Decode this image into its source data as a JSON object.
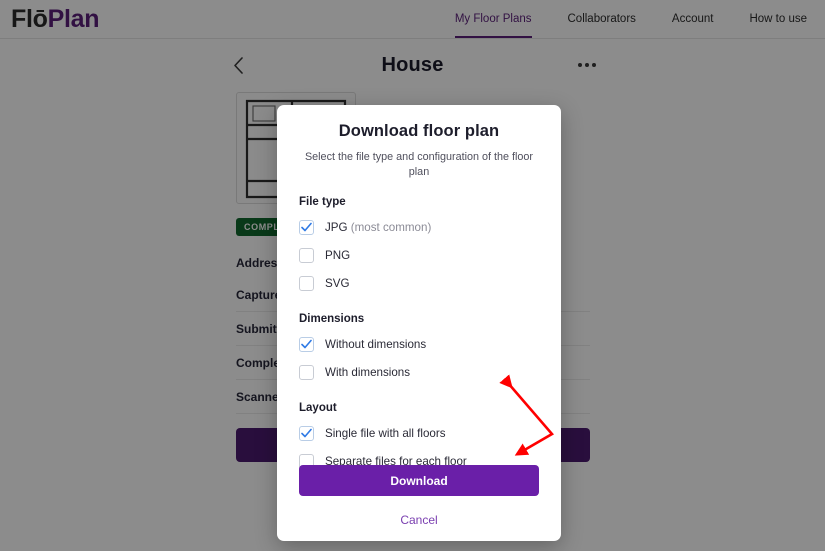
{
  "header": {
    "logo_primary": "Flō",
    "logo_accent": "Plan",
    "nav": [
      {
        "label": "My Floor Plans",
        "active": true
      },
      {
        "label": "Collaborators",
        "active": false
      },
      {
        "label": "Account",
        "active": false
      },
      {
        "label": "How to use",
        "active": false
      }
    ]
  },
  "detail": {
    "title": "House",
    "back_icon": "chevron-left-icon",
    "more_icon": "ellipsis-icon",
    "status_badge": "COMPLETED",
    "fields": [
      {
        "label": "Address",
        "value": ""
      },
      {
        "label": "Captured",
        "value": ""
      },
      {
        "label": "Submitted",
        "value": ""
      },
      {
        "label": "Completed",
        "value": ""
      },
      {
        "label": "Scanned by",
        "value": ""
      }
    ],
    "actions": [
      {
        "label": ""
      },
      {
        "label": ""
      }
    ]
  },
  "modal": {
    "title": "Download floor plan",
    "subtitle": "Select the file type and configuration of the floor plan",
    "groups": [
      {
        "title": "File type",
        "options": [
          {
            "label": "JPG",
            "suffix": " (most common)",
            "checked": true
          },
          {
            "label": "PNG",
            "suffix": "",
            "checked": false
          },
          {
            "label": "SVG",
            "suffix": "",
            "checked": false
          }
        ]
      },
      {
        "title": "Dimensions",
        "options": [
          {
            "label": "Without dimensions",
            "suffix": "",
            "checked": true
          },
          {
            "label": "With dimensions",
            "suffix": "",
            "checked": false
          }
        ]
      },
      {
        "title": "Layout",
        "options": [
          {
            "label": "Single file with all floors",
            "suffix": "",
            "checked": true
          },
          {
            "label": "Separate files for each floor",
            "suffix": "",
            "checked": false
          }
        ]
      }
    ],
    "download_label": "Download",
    "cancel_label": "Cancel"
  },
  "annotation": {
    "color": "#ff0000",
    "shape": "double-headed-v-arrow"
  },
  "colors": {
    "brand_purple": "#5b1f7a",
    "button_purple": "#6a1fa8",
    "badge_green": "#12682f",
    "check_blue": "#2f7ae5"
  }
}
